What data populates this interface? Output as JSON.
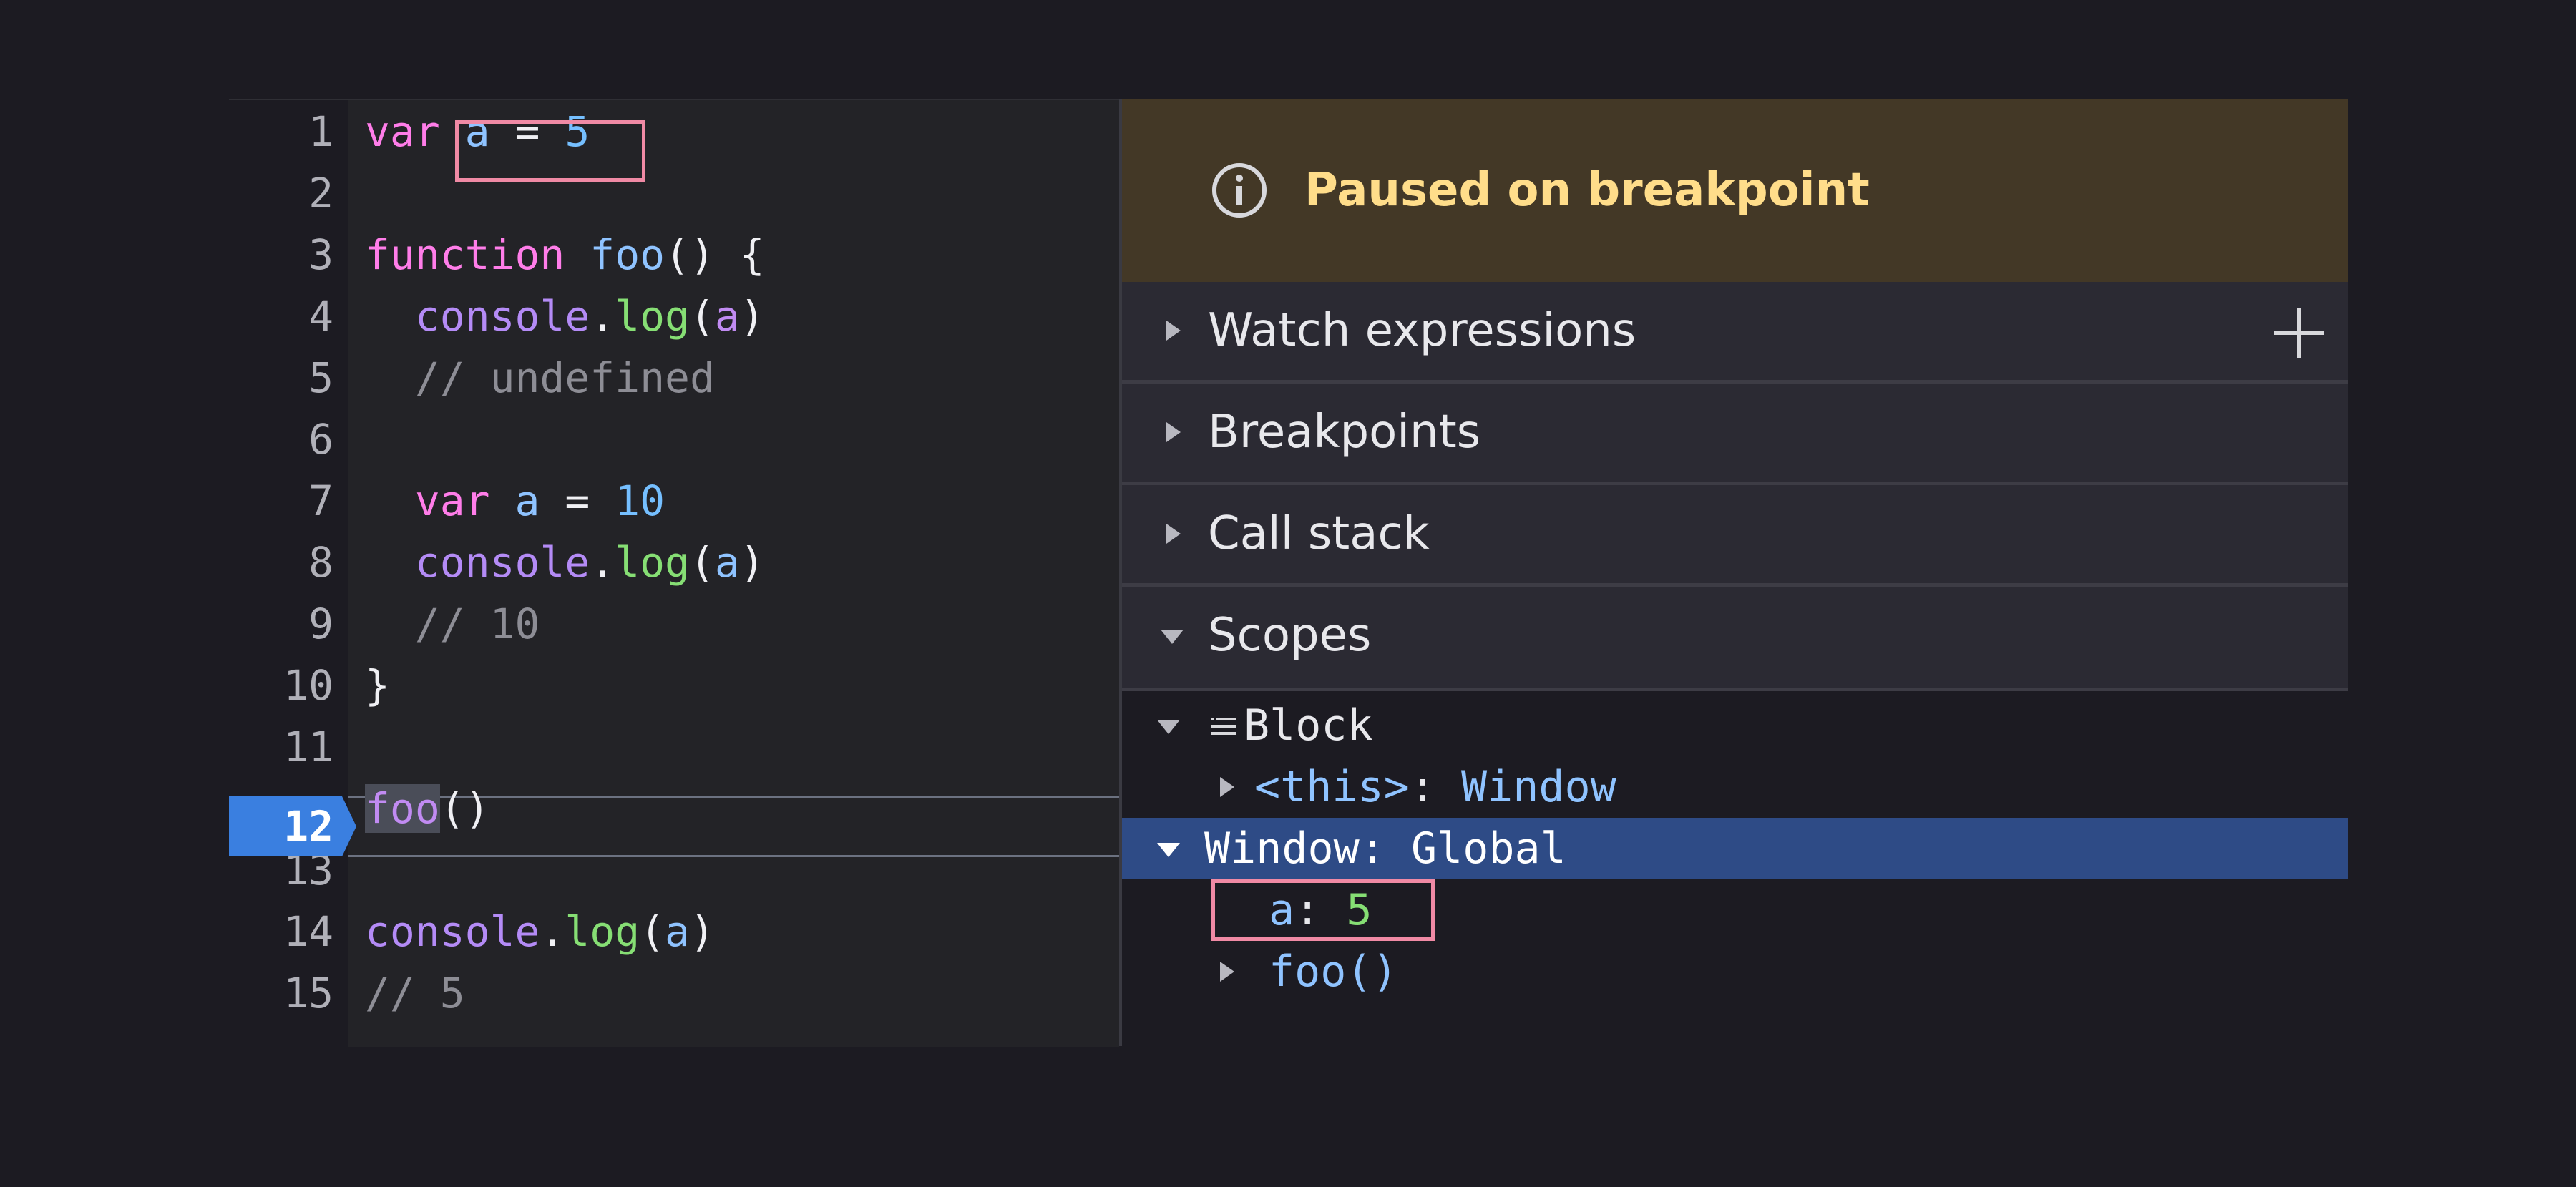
{
  "editor": {
    "lines": [
      {
        "num": "1",
        "tokens": [
          {
            "t": "var",
            "c": "kw"
          },
          {
            "t": " a",
            "c": "id"
          },
          {
            "t": " = ",
            "c": "plain"
          },
          {
            "t": "5",
            "c": "num"
          }
        ]
      },
      {
        "num": "2",
        "tokens": []
      },
      {
        "num": "3",
        "tokens": [
          {
            "t": "function",
            "c": "kw"
          },
          {
            "t": " ",
            "c": "plain"
          },
          {
            "t": "foo",
            "c": "fn"
          },
          {
            "t": "() {",
            "c": "plain"
          }
        ]
      },
      {
        "num": "4",
        "tokens": [
          {
            "t": "  ",
            "c": "plain"
          },
          {
            "t": "console",
            "c": "obj"
          },
          {
            "t": ".",
            "c": "plain"
          },
          {
            "t": "log",
            "c": "mth"
          },
          {
            "t": "(",
            "c": "plain"
          },
          {
            "t": "a",
            "c": "purp"
          },
          {
            "t": ")",
            "c": "plain"
          }
        ]
      },
      {
        "num": "5",
        "tokens": [
          {
            "t": "  // undefined",
            "c": "cm"
          }
        ]
      },
      {
        "num": "6",
        "tokens": []
      },
      {
        "num": "7",
        "tokens": [
          {
            "t": "  ",
            "c": "plain"
          },
          {
            "t": "var",
            "c": "kw"
          },
          {
            "t": " a",
            "c": "id"
          },
          {
            "t": " = ",
            "c": "plain"
          },
          {
            "t": "10",
            "c": "num"
          }
        ]
      },
      {
        "num": "8",
        "tokens": [
          {
            "t": "  ",
            "c": "plain"
          },
          {
            "t": "console",
            "c": "obj"
          },
          {
            "t": ".",
            "c": "plain"
          },
          {
            "t": "log",
            "c": "mth"
          },
          {
            "t": "(",
            "c": "plain"
          },
          {
            "t": "a",
            "c": "id"
          },
          {
            "t": ")",
            "c": "plain"
          }
        ]
      },
      {
        "num": "9",
        "tokens": [
          {
            "t": "  // 10",
            "c": "cm"
          }
        ]
      },
      {
        "num": "10",
        "tokens": [
          {
            "t": "}",
            "c": "plain"
          }
        ]
      },
      {
        "num": "11",
        "tokens": []
      },
      {
        "num": "12",
        "tokens": [
          {
            "t": "foo",
            "c": "purp",
            "hl": true
          },
          {
            "t": "()",
            "c": "plain"
          }
        ]
      },
      {
        "num": "13",
        "tokens": []
      },
      {
        "num": "14",
        "tokens": [
          {
            "t": "console",
            "c": "obj"
          },
          {
            "t": ".",
            "c": "plain"
          },
          {
            "t": "log",
            "c": "mth"
          },
          {
            "t": "(",
            "c": "plain"
          },
          {
            "t": "a",
            "c": "id"
          },
          {
            "t": ")",
            "c": "plain"
          }
        ]
      },
      {
        "num": "15",
        "tokens": [
          {
            "t": "// 5",
            "c": "cm"
          }
        ]
      }
    ],
    "paused_line": "12"
  },
  "sidebar": {
    "banner": {
      "text": "Paused on breakpoint",
      "icon": "info-icon"
    },
    "sections": {
      "watch": "Watch expressions",
      "breakpoints": "Breakpoints",
      "callstack": "Call stack",
      "scopes": "Scopes"
    },
    "scopes": {
      "block_label": "Block",
      "this_key": "<this>",
      "this_sep": ": ",
      "this_value": "Window",
      "window_label": "Window: Global",
      "var_a_key": "a",
      "var_a_sep": ": ",
      "var_a_value": "5",
      "foo_label": "foo()"
    }
  },
  "colors": {
    "background": "#1c1b22",
    "banner": "#433826",
    "banner_text": "#ffdd8a",
    "selected_row": "#2e4b86",
    "breakpoint": "#3a7fe0",
    "annotation_box": "#f08aa5"
  }
}
